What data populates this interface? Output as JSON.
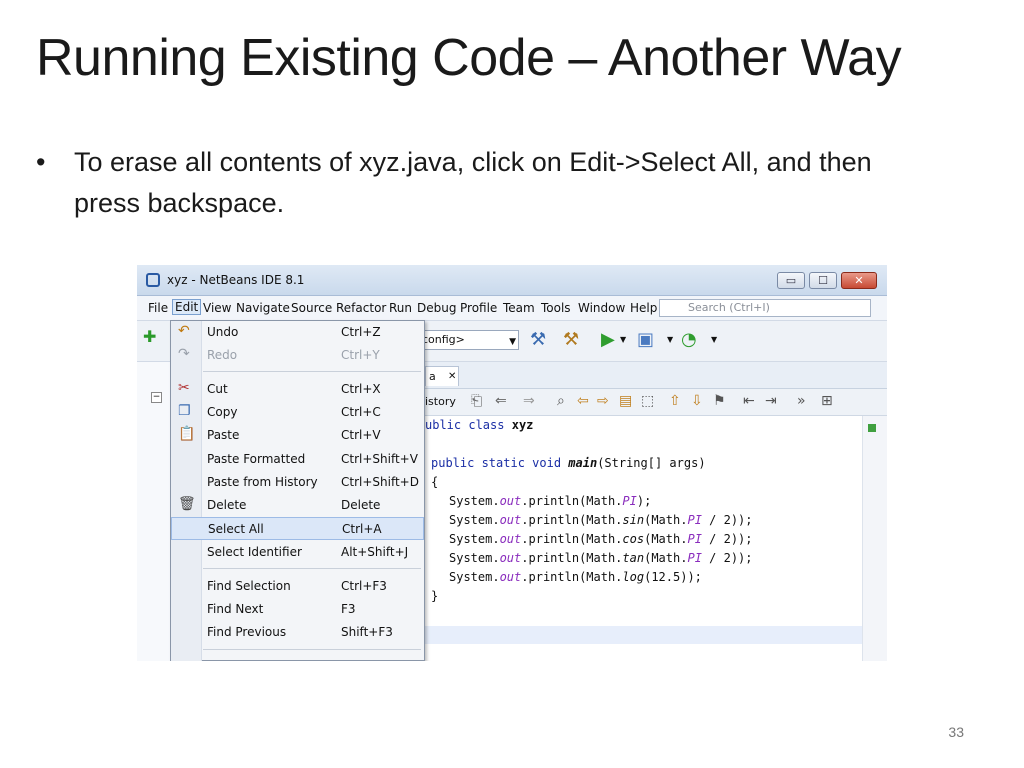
{
  "slide": {
    "title": "Running Existing Code – Another Way",
    "bullet_symbol": "•",
    "bullet": "To erase all contents of xyz.java, click on Edit->Select All, and then press backspace.",
    "page_number": "33"
  },
  "window": {
    "title": "xyz - NetBeans IDE 8.1",
    "buttons": {
      "minimize": "▭",
      "maximize": "☐",
      "close": "✕"
    }
  },
  "menubar": {
    "items": [
      "File",
      "Edit",
      "View",
      "Navigate",
      "Source",
      "Refactor",
      "Run",
      "Debug",
      "Profile",
      "Team",
      "Tools",
      "Window",
      "Help"
    ],
    "search_placeholder": "Search (Ctrl+I)"
  },
  "toolbar": {
    "config_value": "config>"
  },
  "editor": {
    "tab_label": "a",
    "tab_close": "✕",
    "history_label": "istory",
    "code": {
      "line1_kw1": "ublic",
      "line1_kw2": "class",
      "line1_name": "xyz",
      "line2_kw": "public static void",
      "line2_name": "main",
      "line2_rest": "(String[] args)",
      "brace_open": "{",
      "brace_close": "}",
      "sys": "System.",
      "out": "out",
      "println": ".println(Math.",
      "pi": "PI",
      "l1_end": ");",
      "sin": "sin",
      "cos": "cos",
      "tan": "tan",
      "log": "log",
      "paren": "(Math.",
      "div": " / 2));",
      "log_arg": "(12.5));"
    }
  },
  "edit_menu": {
    "items": [
      {
        "label": "Undo",
        "shortcut": "Ctrl+Z",
        "icon": "undo-icon"
      },
      {
        "label": "Redo",
        "shortcut": "Ctrl+Y",
        "icon": "redo-icon",
        "disabled": true
      },
      {
        "label": "Cut",
        "shortcut": "Ctrl+X",
        "icon": "scissors-icon"
      },
      {
        "label": "Copy",
        "shortcut": "Ctrl+C",
        "icon": "copy-icon"
      },
      {
        "label": "Paste",
        "shortcut": "Ctrl+V",
        "icon": "clipboard-icon"
      },
      {
        "label": "Paste Formatted",
        "shortcut": "Ctrl+Shift+V"
      },
      {
        "label": "Paste from History",
        "shortcut": "Ctrl+Shift+D"
      },
      {
        "label": "Delete",
        "shortcut": "Delete",
        "icon": "trash-icon"
      },
      {
        "label": "Select All",
        "shortcut": "Ctrl+A",
        "selected": true
      },
      {
        "label": "Select Identifier",
        "shortcut": "Alt+Shift+J"
      },
      {
        "label": "Find Selection",
        "shortcut": "Ctrl+F3"
      },
      {
        "label": "Find Next",
        "shortcut": "F3"
      },
      {
        "label": "Find Previous",
        "shortcut": "Shift+F3"
      }
    ]
  }
}
